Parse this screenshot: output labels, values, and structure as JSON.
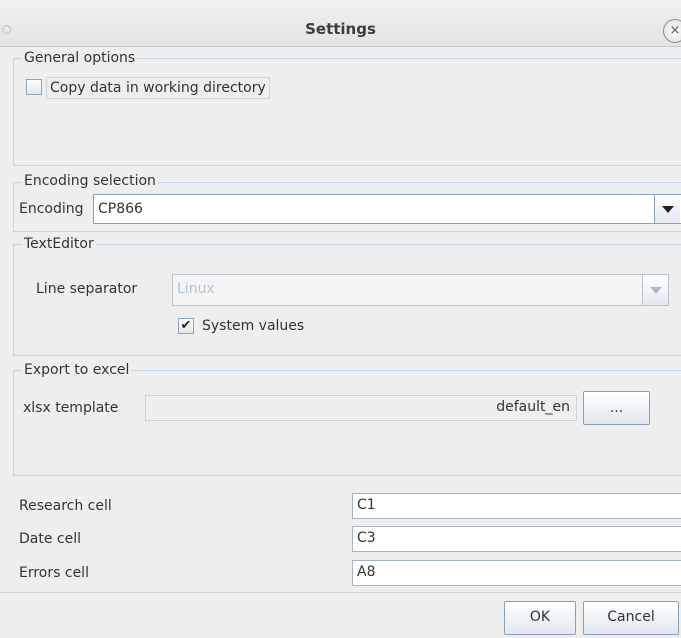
{
  "window": {
    "title": "Settings",
    "close_symbol": "×"
  },
  "general": {
    "legend": "General options",
    "copy_data_label": "Copy data in working directory",
    "copy_data_checked": false
  },
  "encoding": {
    "legend": "Encoding selection",
    "label": "Encoding",
    "value": "CP866"
  },
  "text_editor": {
    "legend": "TextEditor",
    "line_separator_label": "Line separator",
    "line_separator_value": "Linux",
    "line_separator_enabled": false,
    "system_values_label": "System values",
    "system_values_checked": true,
    "check_mark": "✔"
  },
  "export": {
    "legend": "Export to excel",
    "template_label": "xlsx template",
    "template_value": "default_en",
    "browse_label": "...",
    "research_cell_label": "Research cell",
    "research_cell_value": "C1",
    "date_cell_label": "Date cell",
    "date_cell_value": "C3",
    "errors_cell_label": "Errors cell",
    "errors_cell_value": "A8"
  },
  "buttons": {
    "ok": "OK",
    "cancel": "Cancel"
  }
}
